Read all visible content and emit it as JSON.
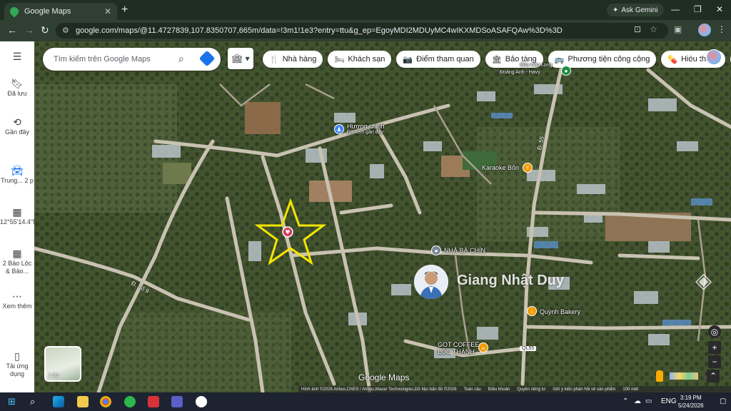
{
  "browser": {
    "tab_title": "Google Maps",
    "tab_close": "✕",
    "new_tab": "+",
    "gemini_label": "Ask Gemini",
    "url": "google.com/maps/@11.4727839,107.8350707,665m/data=!3m1!1e3?entry=ttu&g_ep=EgoyMDI2MDUyMC4wIKXMDSoASAFQAw%3D%3D"
  },
  "rail": {
    "saved": "Đã lưu",
    "recent": "Gần đây",
    "item1": "Trung... 2 p",
    "item2": "12°55'14.4\"N...",
    "item3": "2 Bảo Lộc & Bảo...",
    "more": "Xem thêm",
    "install": "Tải ứng dụng"
  },
  "search": {
    "placeholder": "Tìm kiếm trên Google Maps"
  },
  "chips": [
    {
      "icon": "🍴",
      "label": "Nhà hàng"
    },
    {
      "icon": "🛏",
      "label": "Khách sạn"
    },
    {
      "icon": "📷",
      "label": "Điểm tham quan"
    },
    {
      "icon": "🏛",
      "label": "Bảo tàng"
    },
    {
      "icon": "🚌",
      "label": "Phương tiện công cộng"
    },
    {
      "icon": "💊",
      "label": "Hiệu thuốc"
    }
  ],
  "places": {
    "huong_chinh": "Hương chinh",
    "huong_chinh_sub": "Đã xem gần đây",
    "karaoke": "Karaoke Bốn",
    "nha_ba_chin": "NHÀ BÀ CHÍN",
    "quynh_bakery": "Quỳnh Bakery",
    "got_coffee": "GOT COFFEE",
    "loc_thanh": "LỘC THÀNH",
    "top_right": "Sữa Cao Long",
    "top_right2": "Đoàng Anh - Havy"
  },
  "roads": {
    "d55": "Đ. 55",
    "ds9": "Đ. Số 9",
    "ql55": "QL55"
  },
  "watermark": "Giang Nhật Duy",
  "layers_label": "Lớp",
  "google_logo": "Google Maps",
  "footer": {
    "imagery": "Hình ảnh ©2026 Airbus,CNES / Airbus,Maxar Technologies,Dữ liệu bản đồ ©2026",
    "global": "Toàn cầu",
    "terms": "Điều khoản",
    "privacy": "Quyền riêng tư",
    "feedback": "Gửi ý kiến phản hồi về sản phẩm",
    "scale": "100 mét"
  },
  "taskbar": {
    "lang": "ENG",
    "time": "3:19 PM",
    "date": "5/24/2026"
  }
}
